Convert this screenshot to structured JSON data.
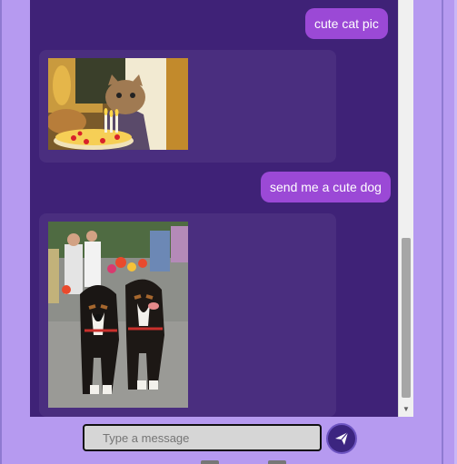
{
  "messages": [
    {
      "role": "user",
      "text": "cute cat pic"
    },
    {
      "role": "bot",
      "content": "image",
      "subject": "cat"
    },
    {
      "role": "user",
      "text": "send me a cute dog"
    },
    {
      "role": "bot",
      "content": "image",
      "subject": "dogs"
    }
  ],
  "composer": {
    "placeholder": "Type a message",
    "send_icon": "paper-plane-icon"
  },
  "colors": {
    "page_background": "#b69af0",
    "chat_background": "#3f2277",
    "user_bubble": "#9b49d6",
    "bot_card": "#4a2e7f",
    "send_button": "#3c2580"
  }
}
